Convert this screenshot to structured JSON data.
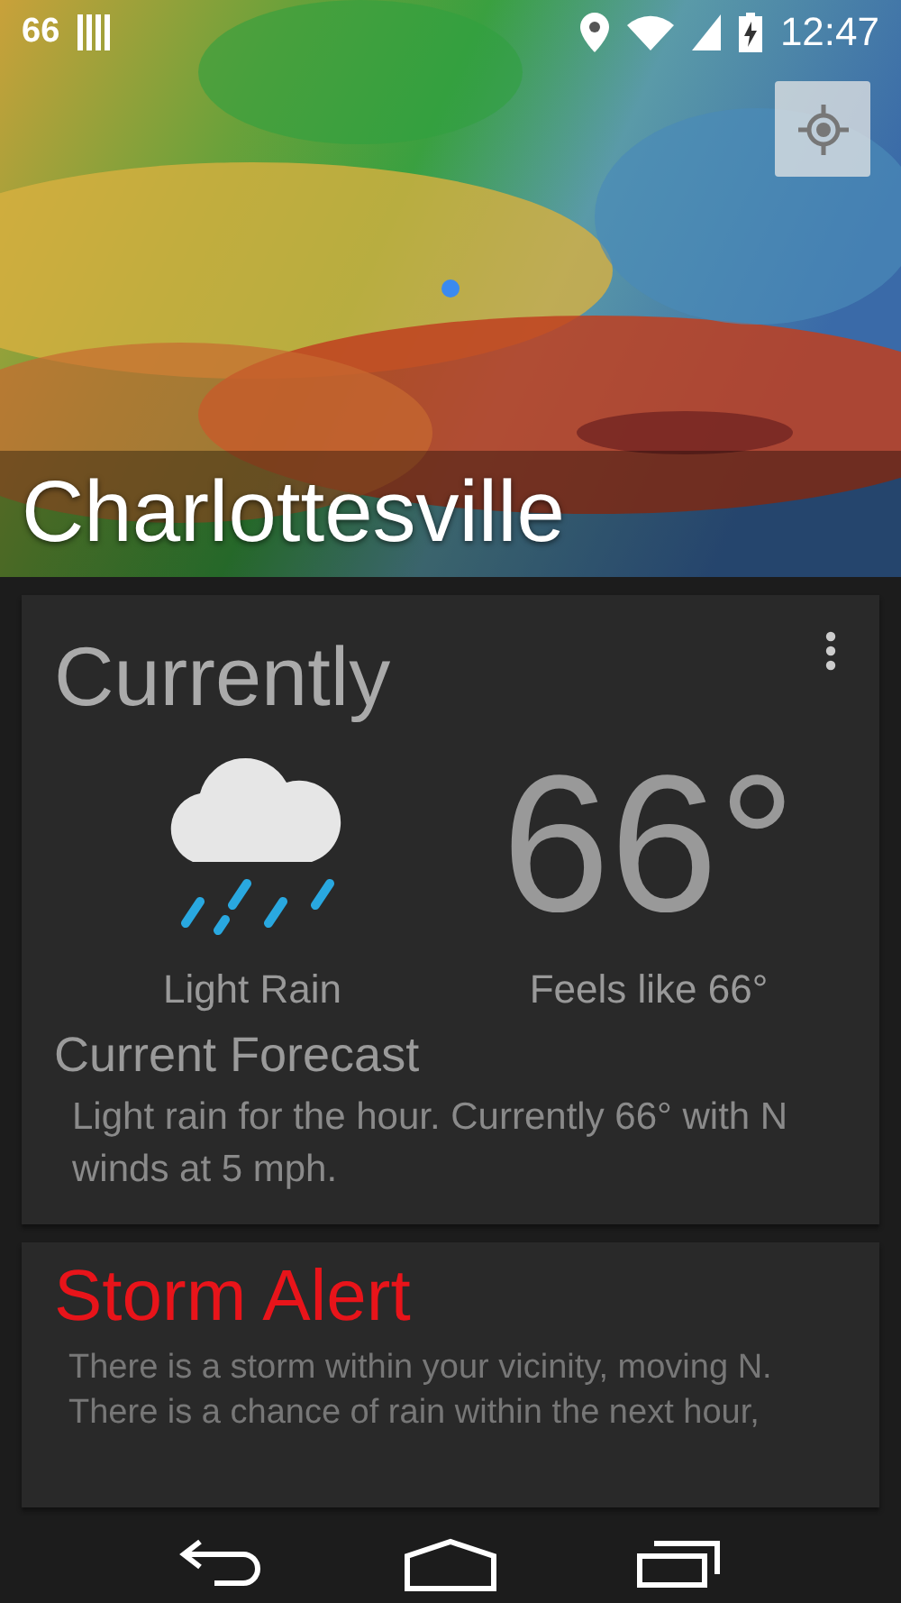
{
  "status_bar": {
    "temperature": "66",
    "time": "12:47"
  },
  "map": {
    "city": "Charlottesville"
  },
  "current": {
    "title": "Currently",
    "condition": "Light Rain",
    "temperature": "66°",
    "feels_like": "Feels like 66°",
    "forecast_title": "Current Forecast",
    "forecast_text": "Light rain for the hour. Currently 66° with N winds at 5 mph."
  },
  "alert": {
    "title": "Storm Alert",
    "text": "There is a storm within your vicinity, moving N. There is a chance of rain within the next hour,"
  }
}
